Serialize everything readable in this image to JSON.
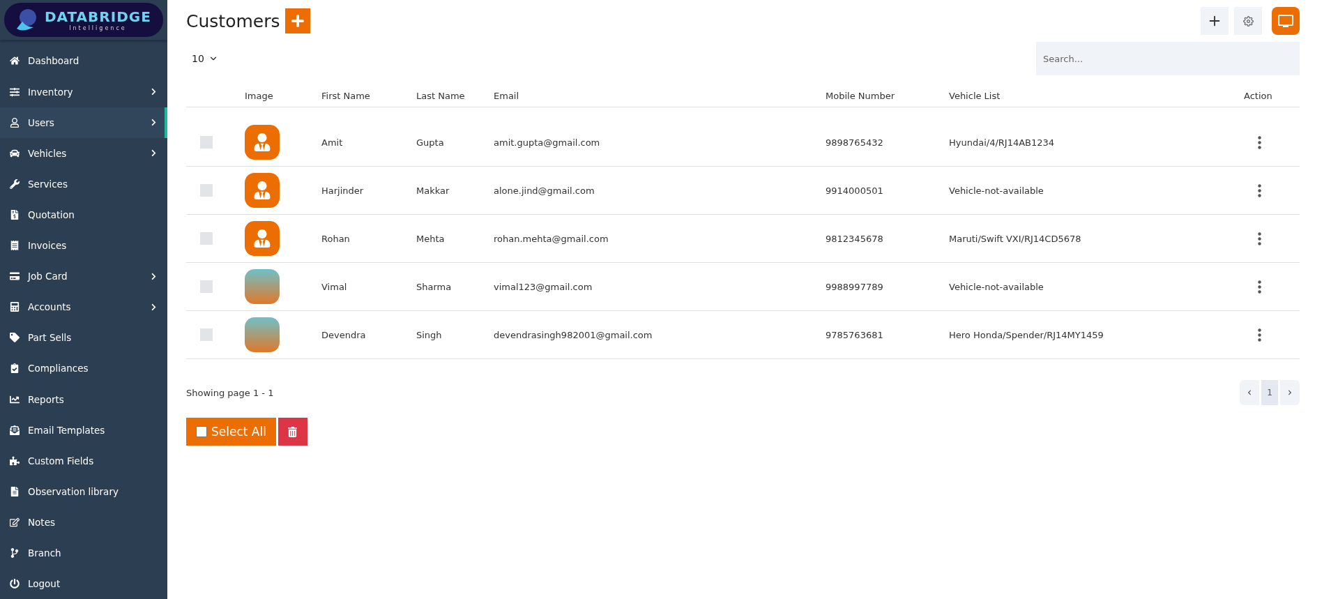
{
  "logo": {
    "name": "DATABRIDGE",
    "tagline": "Intelligence"
  },
  "sidebar": {
    "items": [
      {
        "label": "Dashboard",
        "selected": false,
        "expandable": false
      },
      {
        "label": "Inventory",
        "selected": false,
        "expandable": true
      },
      {
        "label": "Users",
        "selected": true,
        "expandable": true
      },
      {
        "label": "Vehicles",
        "selected": false,
        "expandable": true
      },
      {
        "label": "Services",
        "selected": false,
        "expandable": false
      },
      {
        "label": "Quotation",
        "selected": false,
        "expandable": false
      },
      {
        "label": "Invoices",
        "selected": false,
        "expandable": false
      },
      {
        "label": "Job Card",
        "selected": false,
        "expandable": true
      },
      {
        "label": "Accounts",
        "selected": false,
        "expandable": true
      },
      {
        "label": "Part Sells",
        "selected": false,
        "expandable": false
      },
      {
        "label": "Compliances",
        "selected": false,
        "expandable": false
      },
      {
        "label": "Reports",
        "selected": false,
        "expandable": false
      },
      {
        "label": "Email Templates",
        "selected": false,
        "expandable": false
      },
      {
        "label": "Custom Fields",
        "selected": false,
        "expandable": false
      },
      {
        "label": "Observation library",
        "selected": false,
        "expandable": false
      },
      {
        "label": "Notes",
        "selected": false,
        "expandable": false
      },
      {
        "label": "Branch",
        "selected": false,
        "expandable": false
      },
      {
        "label": "Logout",
        "selected": false,
        "expandable": false
      }
    ]
  },
  "page": {
    "title": "Customers"
  },
  "page_size": "10",
  "search": {
    "placeholder": "Search..."
  },
  "table": {
    "columns": [
      "Image",
      "First Name",
      "Last Name",
      "Email",
      "Mobile Number",
      "Vehicle List",
      "Action"
    ],
    "rows": [
      {
        "checked": false,
        "kind": "icon",
        "first_name": "Amit",
        "last_name": "Gupta",
        "email": "amit.gupta@gmail.com",
        "mobile": "9898765432",
        "vehicles": "Hyundai/4/RJ14AB1234"
      },
      {
        "checked": false,
        "kind": "icon",
        "first_name": "Harjinder",
        "last_name": "Makkar",
        "email": "alone.jind@gmail.com",
        "mobile": "9914000501",
        "vehicles": "Vehicle-not-available"
      },
      {
        "checked": false,
        "kind": "icon",
        "first_name": "Rohan",
        "last_name": "Mehta",
        "email": "rohan.mehta@gmail.com",
        "mobile": "9812345678",
        "vehicles": "Maruti/Swift VXI/RJ14CD5678"
      },
      {
        "checked": false,
        "kind": "photo",
        "first_name": "Vimal",
        "last_name": "Sharma",
        "email": "vimal123@gmail.com",
        "mobile": "9988997789",
        "vehicles": "Vehicle-not-available"
      },
      {
        "checked": false,
        "kind": "photo",
        "first_name": "Devendra",
        "last_name": "Singh",
        "email": "devendrasingh982001@gmail.com",
        "mobile": "9785763681",
        "vehicles": "Hero Honda/Spender/RJ14MY1459"
      }
    ]
  },
  "footer": {
    "showing": "Showing page 1 - 1",
    "pages": [
      {
        "label": "1",
        "selected": true
      }
    ]
  },
  "select_all": {
    "label": "Select All",
    "checked": false
  }
}
